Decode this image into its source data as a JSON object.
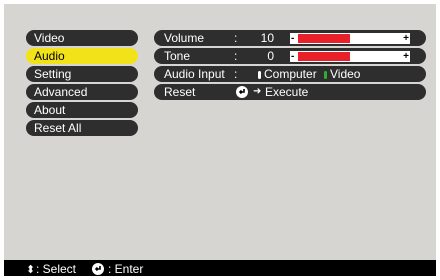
{
  "menu": {
    "items": [
      {
        "label": "Video",
        "selected": false
      },
      {
        "label": "Audio",
        "selected": true
      },
      {
        "label": "Setting",
        "selected": false
      },
      {
        "label": "Advanced",
        "selected": false
      },
      {
        "label": "About",
        "selected": false
      },
      {
        "label": "Reset All",
        "selected": false
      }
    ]
  },
  "settings": {
    "volume": {
      "label": "Volume",
      "colon": ":",
      "value": "10",
      "level_fraction": 0.5,
      "minus": "-",
      "plus": "+"
    },
    "tone": {
      "label": "Tone",
      "colon": ":",
      "value": "0",
      "level_fraction": 0.5,
      "minus": "-",
      "plus": "+"
    },
    "audio_input": {
      "label": "Audio Input",
      "colon": ":",
      "option_computer": "Computer",
      "option_video": "Video",
      "selected": "Video"
    },
    "reset": {
      "label": "Reset",
      "action": "Execute"
    }
  },
  "footer": {
    "select_label": ": Select",
    "enter_label": ": Enter"
  },
  "colors": {
    "selected_item": "#f2e21a",
    "bar_fill": "#e8202a",
    "radio_selected": "#2fae2f",
    "panel": "#d7d5d2"
  }
}
